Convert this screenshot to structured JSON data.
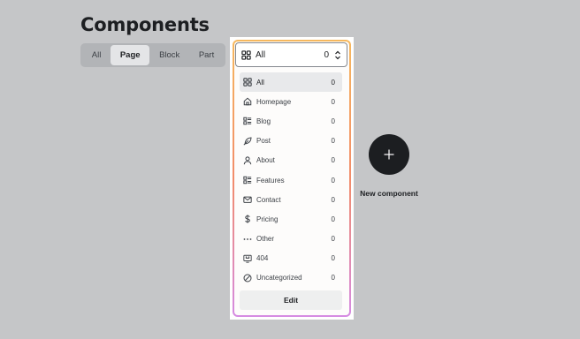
{
  "page": {
    "title": "Components"
  },
  "tabs": [
    {
      "label": "All",
      "active": false
    },
    {
      "label": "Page",
      "active": true
    },
    {
      "label": "Block",
      "active": false
    },
    {
      "label": "Part",
      "active": false
    }
  ],
  "selector": {
    "icon": "grid-icon",
    "label": "All",
    "count": "0",
    "chevron": "chevron-up-down-icon"
  },
  "categories": [
    {
      "icon": "grid-icon",
      "label": "All",
      "count": "0",
      "active": true
    },
    {
      "icon": "home-icon",
      "label": "Homepage",
      "count": "0"
    },
    {
      "icon": "list-icon",
      "label": "Blog",
      "count": "0"
    },
    {
      "icon": "feather-icon",
      "label": "Post",
      "count": "0"
    },
    {
      "icon": "person-icon",
      "label": "About",
      "count": "0"
    },
    {
      "icon": "list-icon",
      "label": "Features",
      "count": "0"
    },
    {
      "icon": "mail-icon",
      "label": "Contact",
      "count": "0"
    },
    {
      "icon": "dollar-icon",
      "label": "Pricing",
      "count": "0"
    },
    {
      "icon": "dots-icon",
      "label": "Other",
      "count": "0"
    },
    {
      "icon": "monitor-icon",
      "label": "404",
      "count": "0"
    },
    {
      "icon": "no-entry-icon",
      "label": "Uncategorized",
      "count": "0"
    }
  ],
  "edit_label": "Edit",
  "new_component": {
    "icon": "plus-icon",
    "label": "New component"
  },
  "colors": {
    "background": "#c5c6c8",
    "button_dark": "#1c1e21",
    "frame_gradient_top": "#f6b85e",
    "frame_gradient_bottom": "#d58be3"
  }
}
